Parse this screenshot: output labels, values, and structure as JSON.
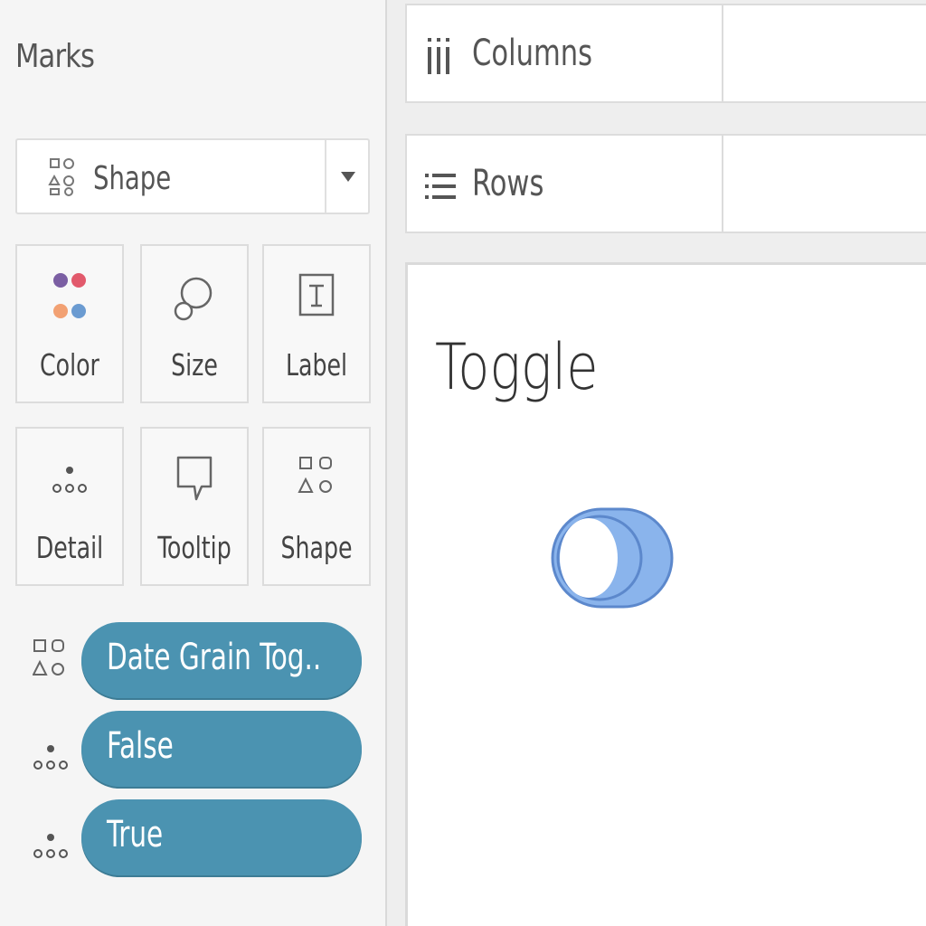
{
  "marks": {
    "title": "Marks",
    "mark_type": {
      "label": "Shape",
      "icon": "shape-icon"
    },
    "cards": [
      {
        "label": "Color",
        "icon": "color-icon"
      },
      {
        "label": "Size",
        "icon": "size-icon"
      },
      {
        "label": "Label",
        "icon": "label-icon"
      },
      {
        "label": "Detail",
        "icon": "detail-icon"
      },
      {
        "label": "Tooltip",
        "icon": "tooltip-icon"
      },
      {
        "label": "Shape",
        "icon": "shape-icon"
      }
    ],
    "fields": [
      {
        "label": "Date Grain Tog..",
        "icon": "shape-icon"
      },
      {
        "label": "False",
        "icon": "detail-icon"
      },
      {
        "label": "True",
        "icon": "detail-icon"
      }
    ]
  },
  "shelves": {
    "columns": {
      "label": "Columns",
      "icon": "columns-icon"
    },
    "rows": {
      "label": "Rows",
      "icon": "rows-icon"
    }
  },
  "view": {
    "title": "Toggle",
    "toggle_state": "off"
  },
  "colors": {
    "pill": "#4b93b1",
    "toggle": "#8ab4ec"
  }
}
